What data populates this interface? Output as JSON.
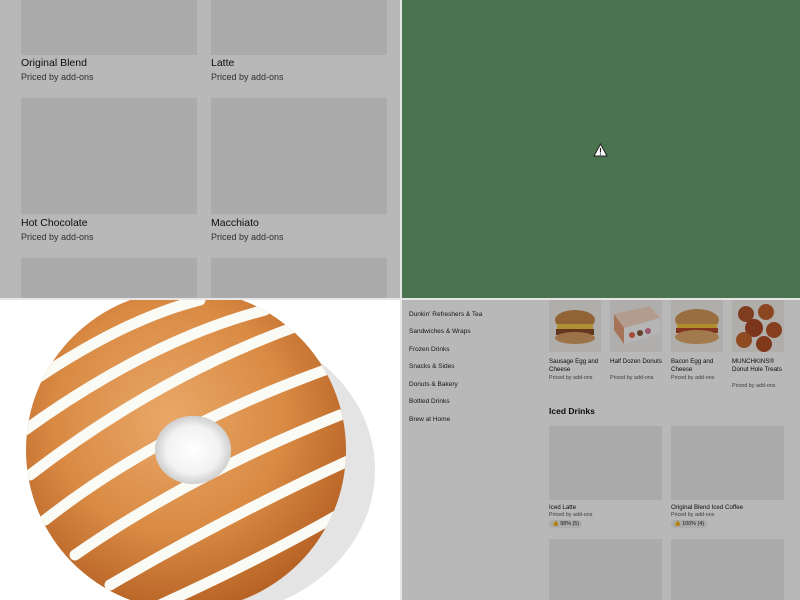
{
  "top_left": {
    "cards": [
      {
        "title": "Original Blend",
        "subtitle": "Priced by add-ons"
      },
      {
        "title": "Latte",
        "subtitle": "Priced by add-ons"
      },
      {
        "title": "Hot Chocolate",
        "subtitle": "Priced by add-ons"
      },
      {
        "title": "Macchiato",
        "subtitle": "Priced by add-ons"
      }
    ]
  },
  "top_right": {
    "icon": "warning-icon",
    "color": "#4a7450"
  },
  "bottom_left": {
    "image": "glazed-donut-with-icing-stripes"
  },
  "bottom_right": {
    "nav": [
      "Dunkin' Refreshers & Tea",
      "Sandwiches & Wraps",
      "Frozen Drinks",
      "Snacks & Sides",
      "Donuts & Bakery",
      "Bottled Drinks",
      "Brew at Home"
    ],
    "products": [
      {
        "name": "Sausage Egg and Cheese",
        "sub": "Priced by add-ons"
      },
      {
        "name": "Half Dozen Donuts",
        "sub": "Priced by add-ons"
      },
      {
        "name": "Bacon Egg and Cheese",
        "sub": "Priced by add-ons"
      },
      {
        "name": "MUNCHKINS® Donut Hole Treats",
        "sub": "Priced by add-ons"
      }
    ],
    "section_title": "Iced Drinks",
    "iced": [
      {
        "name": "Iced Latte",
        "sub": "Priced by add-ons",
        "rating": "98% (5)"
      },
      {
        "name": "Original Blend Iced Coffee",
        "sub": "Priced by add-ons",
        "rating": "100% (4)"
      }
    ]
  }
}
